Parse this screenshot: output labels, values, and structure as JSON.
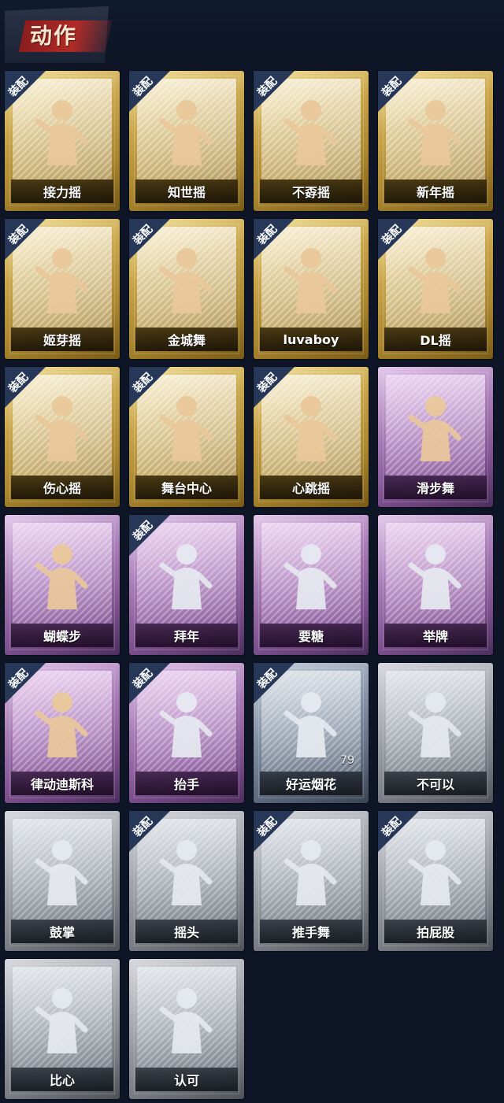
{
  "header": {
    "title": "动作"
  },
  "equip_label": "装配",
  "cards": [
    {
      "label": "接力摇",
      "equipped": true,
      "rarity": "gold",
      "icon": "dance-figure-icon"
    },
    {
      "label": "知世摇",
      "equipped": true,
      "rarity": "gold",
      "icon": "dance-figure-icon"
    },
    {
      "label": "不孬摇",
      "equipped": true,
      "rarity": "gold",
      "icon": "dance-figure-icon"
    },
    {
      "label": "新年摇",
      "equipped": true,
      "rarity": "gold",
      "icon": "dance-figure-icon"
    },
    {
      "label": "姬芽摇",
      "equipped": true,
      "rarity": "gold",
      "icon": "dance-figure-icon"
    },
    {
      "label": "金城舞",
      "equipped": true,
      "rarity": "gold",
      "icon": "dance-figure-icon"
    },
    {
      "label": "luvaboy",
      "equipped": true,
      "rarity": "gold",
      "icon": "dance-figure-icon"
    },
    {
      "label": "DL摇",
      "equipped": true,
      "rarity": "gold",
      "icon": "dance-figure-icon"
    },
    {
      "label": "伤心摇",
      "equipped": true,
      "rarity": "gold",
      "icon": "heart-hands-figure-icon"
    },
    {
      "label": "舞台中心",
      "equipped": true,
      "rarity": "gold",
      "icon": "dance-figure-icon"
    },
    {
      "label": "心跳摇",
      "equipped": true,
      "rarity": "gold",
      "icon": "dance-figure-icon"
    },
    {
      "label": "滑步舞",
      "equipped": false,
      "rarity": "purple",
      "icon": "dance-figure-icon"
    },
    {
      "label": "蝴蝶步",
      "equipped": false,
      "rarity": "purple",
      "icon": "dance-figure-icon"
    },
    {
      "label": "拜年",
      "equipped": true,
      "rarity": "purple",
      "icon": "bow-figure-icon"
    },
    {
      "label": "要糖",
      "equipped": false,
      "rarity": "purple",
      "icon": "reach-figure-icon"
    },
    {
      "label": "举牌",
      "equipped": false,
      "rarity": "purple",
      "icon": "sign-figure-icon"
    },
    {
      "label": "律动迪斯科",
      "equipped": true,
      "rarity": "purple",
      "icon": "disco-figure-icon"
    },
    {
      "label": "抬手",
      "equipped": true,
      "rarity": "purple",
      "icon": "raise-hand-figure-icon"
    },
    {
      "label": "好运烟花",
      "equipped": true,
      "rarity": "blue",
      "icon": "firework-icon",
      "count": "79"
    },
    {
      "label": "不可以",
      "equipped": false,
      "rarity": "gray",
      "icon": "finger-wag-icon"
    },
    {
      "label": "鼓掌",
      "equipped": false,
      "rarity": "gray",
      "icon": "clap-icon"
    },
    {
      "label": "摇头",
      "equipped": true,
      "rarity": "gray",
      "icon": "shake-head-figure-icon"
    },
    {
      "label": "推手舞",
      "equipped": true,
      "rarity": "gray",
      "icon": "push-hand-figure-icon"
    },
    {
      "label": "拍屁股",
      "equipped": true,
      "rarity": "gray",
      "icon": "pat-figure-icon"
    },
    {
      "label": "比心",
      "equipped": false,
      "rarity": "gray",
      "icon": "finger-heart-icon"
    },
    {
      "label": "认可",
      "equipped": false,
      "rarity": "gray",
      "icon": "thumbs-up-icon"
    }
  ],
  "colors": {
    "background": "#0d1526",
    "gold": "#c9a64c",
    "purple": "#a77cb6",
    "blue": "#8895a8",
    "gray": "#a3a6ad",
    "equip_badge": "#273758",
    "title_stroke": "#b12a26"
  }
}
